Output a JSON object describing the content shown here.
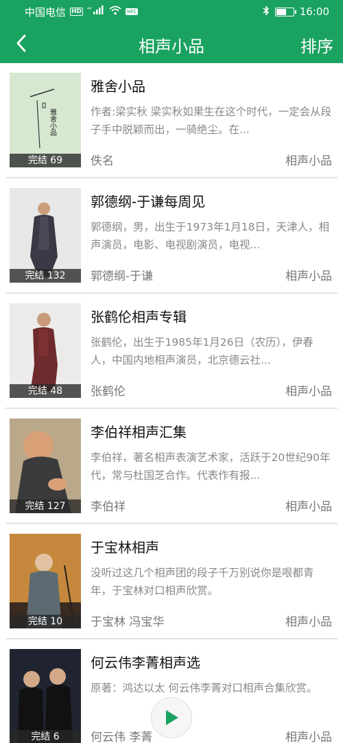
{
  "statusbar": {
    "carrier": "中国电信",
    "hd": "HD",
    "signal_text": "⁴⁶",
    "speed_badge": "NFC",
    "time": "16:00"
  },
  "header": {
    "title": "相声小品",
    "sort_label": "排序"
  },
  "items": [
    {
      "title": "雅舍小品",
      "desc": "作者:梁实秋 梁实秋如果生在这个时代，一定会从段子手中脱颖而出，一骑绝尘。在...",
      "author": "佚名",
      "category": "相声小品",
      "status": "完结 69"
    },
    {
      "title": "郭德纲-于谦每周见",
      "desc": "郭德纲，男，出生于1973年1月18日，天津人，相声演员，电影、电视剧演员，电视...",
      "author": "郭德纲-于谦",
      "category": "相声小品",
      "status": "完结 132"
    },
    {
      "title": "张鹤伦相声专辑",
      "desc": "张鹤伦，出生于1985年1月26日（农历），伊春人，中国内地相声演员，北京德云社...",
      "author": "张鹤伦",
      "category": "相声小品",
      "status": "完结 48"
    },
    {
      "title": "李伯祥相声汇集",
      "desc": "李伯祥，著名相声表演艺术家，活跃于20世纪90年代，常与杜国芝合作。代表作有报...",
      "author": "李伯祥",
      "category": "相声小品",
      "status": "完结 127"
    },
    {
      "title": "于宝林相声",
      "desc": "没听过这几个相声团的段子千万别说你是哏都青年，于宝林对口相声欣赏。",
      "author": "于宝林  冯宝华",
      "category": "相声小品",
      "status": "完结 10"
    },
    {
      "title": "何云伟李菁相声选",
      "desc": "原著：鸿达以太 何云伟李菁对口相声合集欣赏。",
      "author": "何云伟 李菁",
      "category": "相声小品",
      "status": "完结 6"
    }
  ],
  "cover1_text": "雅舍小品",
  "colors": {
    "brand": "#1aa260"
  },
  "icons": {
    "back": "chevron-left-icon",
    "play": "play-icon"
  }
}
